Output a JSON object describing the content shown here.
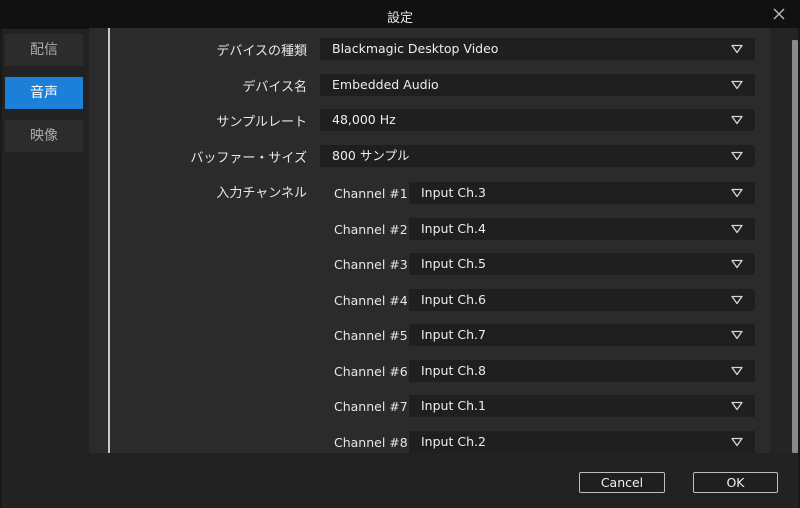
{
  "window": {
    "title": "設定"
  },
  "nav": [
    {
      "label": "配信",
      "active": false
    },
    {
      "label": "音声",
      "active": true
    },
    {
      "label": "映像",
      "active": false
    }
  ],
  "settings": {
    "device_type": {
      "label": "デバイスの種類",
      "value": "Blackmagic Desktop Video"
    },
    "device_name": {
      "label": "デバイス名",
      "value": "Embedded Audio"
    },
    "sample_rate": {
      "label": "サンプルレート",
      "value": "48,000 Hz"
    },
    "buffer_size": {
      "label": "バッファー・サイズ",
      "value": "800 サンプル"
    },
    "input_channels": {
      "label": "入力チャンネル",
      "channels": [
        {
          "name": "Channel #1",
          "value": "Input Ch.3"
        },
        {
          "name": "Channel #2",
          "value": "Input Ch.4"
        },
        {
          "name": "Channel #3",
          "value": "Input Ch.5"
        },
        {
          "name": "Channel #4",
          "value": "Input Ch.6"
        },
        {
          "name": "Channel #5",
          "value": "Input Ch.7"
        },
        {
          "name": "Channel #6",
          "value": "Input Ch.8"
        },
        {
          "name": "Channel #7",
          "value": "Input Ch.1"
        },
        {
          "name": "Channel #8",
          "value": "Input Ch.2"
        }
      ]
    }
  },
  "footer": {
    "cancel_label": "Cancel",
    "ok_label": "OK"
  },
  "colors": {
    "accent": "#1c7fd8",
    "panel": "#2b2b2b",
    "select": "#1f1f1f"
  }
}
